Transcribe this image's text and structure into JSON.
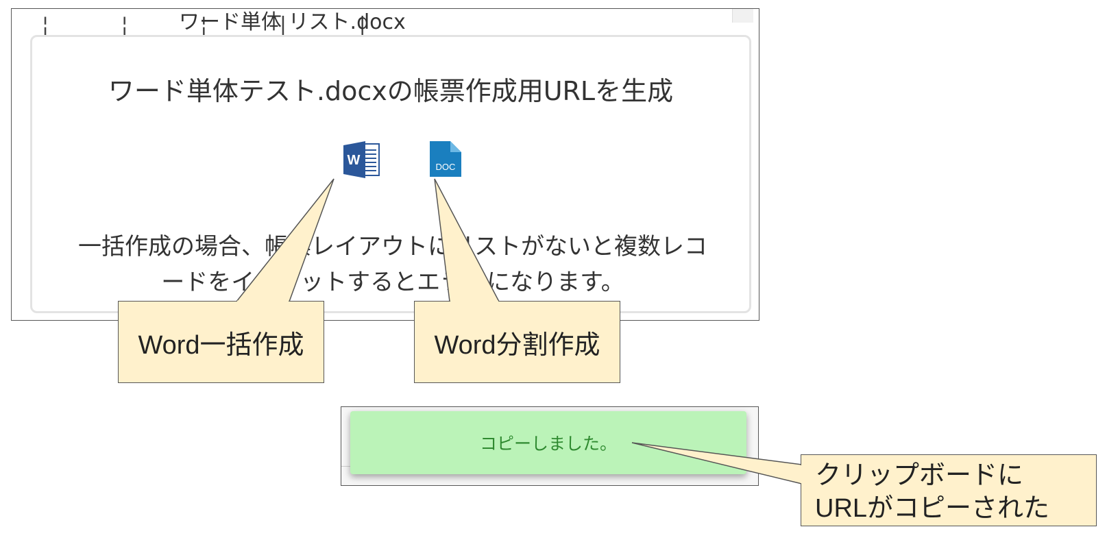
{
  "background_row": {
    "filename": "ワード単体 リスト.docx",
    "guide_marks": "¦ ¦ ¦ | |"
  },
  "dialog": {
    "title": "ワード単体テスト.docxの帳票作成用URLを生成",
    "icons": [
      {
        "name": "word-icon",
        "label": "W"
      },
      {
        "name": "doc-file-icon",
        "label": "DOC"
      }
    ],
    "message_line1": "一括作成の場合、帳票レイアウトにリストがないと複数レコ",
    "message_line2": "ードをインプットするとエラーになります。"
  },
  "toast": {
    "text": "コピーしました。"
  },
  "callouts": {
    "bulk": "Word一括作成",
    "split": "Word分割作成",
    "clipboard_line1": "クリップボードに",
    "clipboard_line2": "URLがコピーされた"
  },
  "colors": {
    "word_blue": "#2b579a",
    "doc_blue": "#1a7fbf",
    "toast_bg": "#bbf3b8",
    "toast_text": "#2f8a30",
    "callout_bg": "#fff1cc"
  }
}
